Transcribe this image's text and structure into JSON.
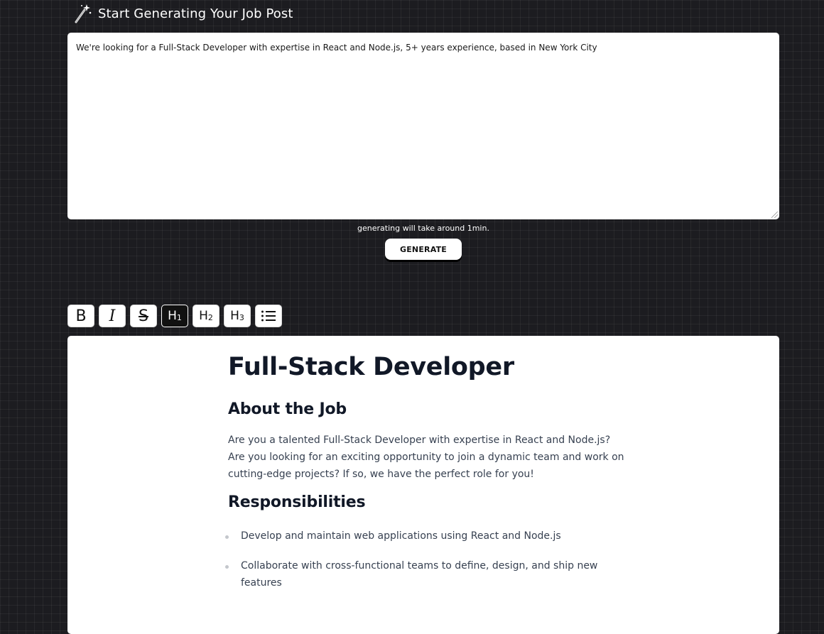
{
  "header": {
    "icon": "magic-wand-icon",
    "title": "Start Generating Your Job Post"
  },
  "prompt": {
    "value": "We're looking for a Full-Stack Developer with expertise in React and Node.js, 5+ years experience, based in New York City"
  },
  "generate": {
    "hint": "generating will take around 1min.",
    "button_label": "GENERATE"
  },
  "toolbar": {
    "bold": "B",
    "italic": "I",
    "strike": "S",
    "h1": "H",
    "h1_level": "1",
    "h2": "H",
    "h2_level": "2",
    "h3": "H",
    "h3_level": "3",
    "list_icon": "bullet-list-icon",
    "active": "h1"
  },
  "document": {
    "title": "Full-Stack Developer",
    "about_heading": "About the Job",
    "about_text": "Are you a talented Full-Stack Developer with expertise in React and Node.js? Are you looking for an exciting opportunity to join a dynamic team and work on cutting-edge projects? If so, we have the perfect role for you!",
    "responsibilities_heading": "Responsibilities",
    "responsibilities": [
      "Develop and maintain web applications using React and Node.js",
      "Collaborate with cross-functional teams to define, design, and ship new features"
    ]
  }
}
